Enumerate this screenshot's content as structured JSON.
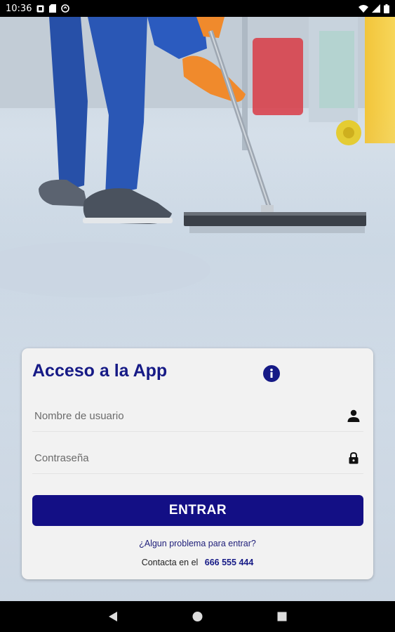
{
  "status_bar": {
    "time": "10:36",
    "left_icons": [
      "notification-icon",
      "sim-icon",
      "sync-icon"
    ],
    "right_icons": [
      "wifi-icon",
      "signal-icon",
      "battery-icon"
    ]
  },
  "background": {
    "description_icon": "cleaning-photo"
  },
  "login": {
    "title": "Acceso a la App",
    "username_placeholder": "Nombre de usuario",
    "password_placeholder": "Contraseña",
    "submit_label": "ENTRAR",
    "help_text": "¿Algun problema para entrar?",
    "contact_text": "Contacta en el",
    "contact_phone": "666 555 444"
  },
  "colors": {
    "brand": "#161a86",
    "button": "#130f85",
    "card_bg": "#f2f2f2"
  },
  "nav_bar": {
    "buttons": [
      "back-icon",
      "home-icon",
      "recents-icon"
    ]
  }
}
